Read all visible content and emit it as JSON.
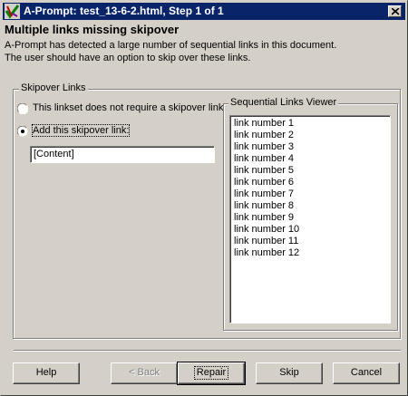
{
  "window": {
    "title": "A-Prompt: test_13-6-2.html, Step 1 of 1",
    "titlebar_color": "#0a246a",
    "app_icon": "aprompt-checkmark-icon",
    "close_icon": "close-icon"
  },
  "header": {
    "heading": "Multiple links missing skipover",
    "description_lines": [
      "A-Prompt has detected a large number of sequential links in this document.",
      "The user should have an option to skip over these links."
    ]
  },
  "skipover": {
    "legend": "Skipover Links",
    "options": [
      {
        "label": "This linkset does not require a skipover link",
        "selected": false
      },
      {
        "label": "Add this skipover link:",
        "selected": true
      }
    ],
    "input_value": "[Content]"
  },
  "viewer": {
    "legend": "Sequential Links Viewer",
    "items": [
      "link number 1",
      "link number 2",
      "link number 3",
      "link number 4",
      "link number 5",
      "link number 6",
      "link number 7",
      "link number 8",
      "link number 9",
      "link number 10",
      "link number 11",
      "link number 12"
    ]
  },
  "buttons": {
    "help": "Help",
    "back": "< Back",
    "repair": "Repair",
    "skip": "Skip",
    "cancel": "Cancel"
  }
}
